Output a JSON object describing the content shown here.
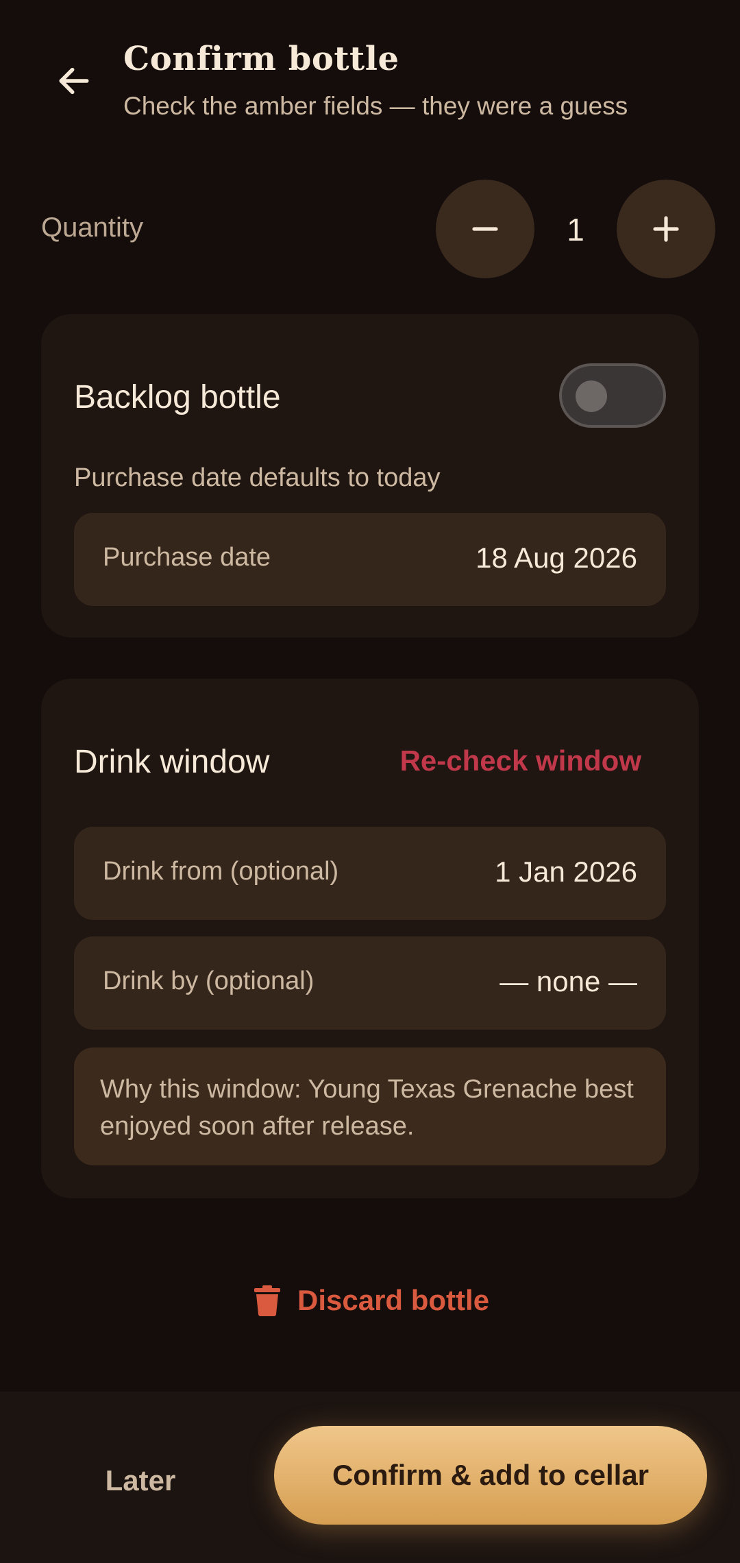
{
  "header": {
    "title": "Confirm bottle",
    "subtitle": "Check the amber fields — they were a guess"
  },
  "quantity": {
    "label": "Quantity",
    "value": "1"
  },
  "backlog": {
    "title": "Backlog bottle",
    "toggle_on": false,
    "helper": "Purchase date defaults to today",
    "purchase_date_label": "Purchase date",
    "purchase_date_value": "18 Aug 2026"
  },
  "drink_window": {
    "title": "Drink window",
    "recheck_label": "Re-check window",
    "from_label": "Drink from (optional)",
    "from_value": "1 Jan 2026",
    "by_label": "Drink by (optional)",
    "by_value": "— none —",
    "note": "Why this window: Young Texas Grenache best enjoyed soon after release."
  },
  "discard_label": "Discard bottle",
  "footer": {
    "later_label": "Later",
    "confirm_label": "Confirm & add to cellar"
  },
  "colors": {
    "background": "#140d0b",
    "card": "#1f1612",
    "field": "#35261c",
    "accent_amber": "#e8b870",
    "recheck_red": "#c0384a",
    "discard_red": "#d95a3e"
  }
}
